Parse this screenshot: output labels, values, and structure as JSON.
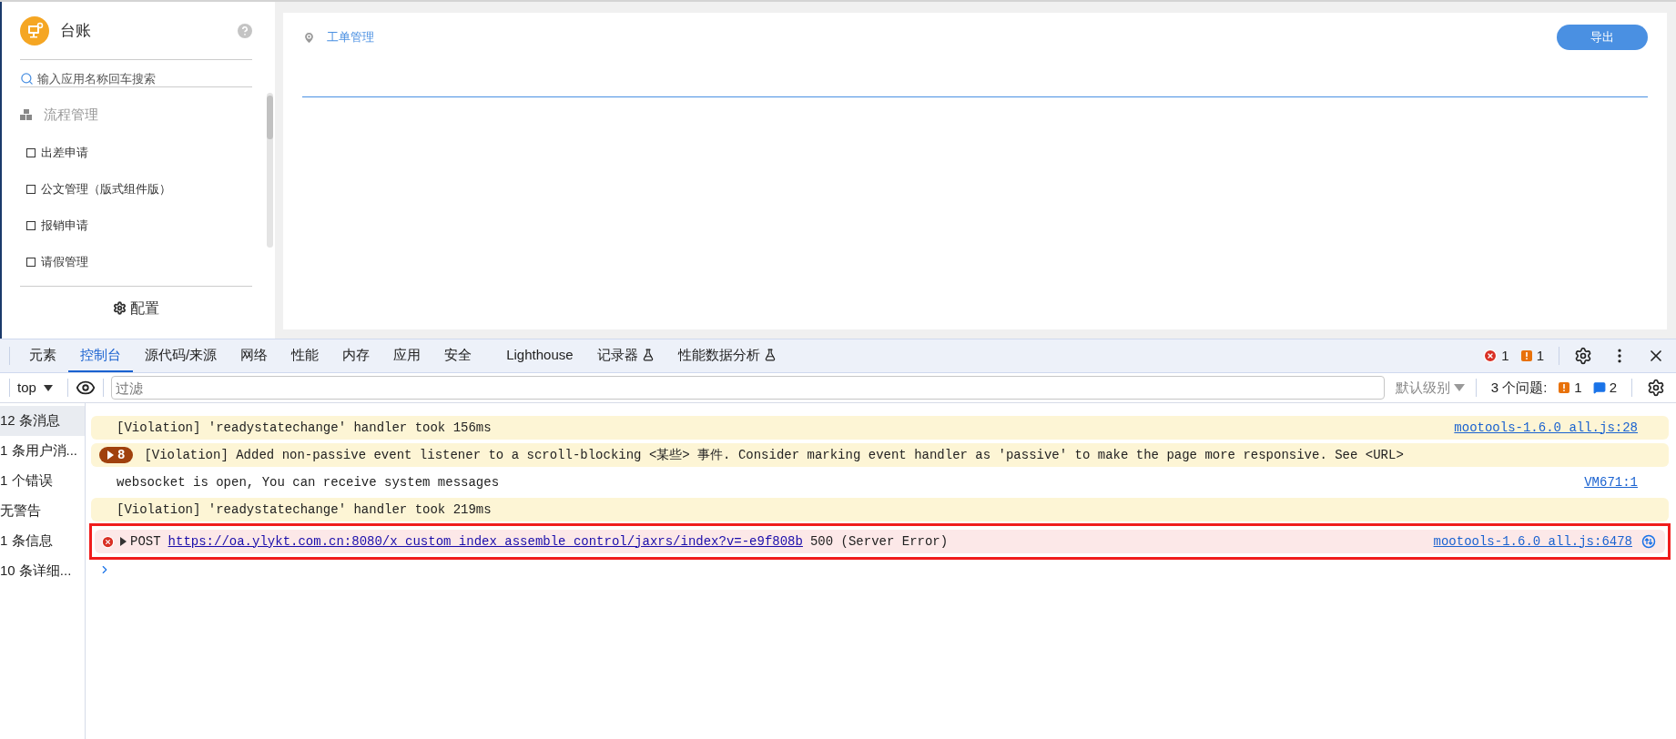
{
  "app": {
    "title": "台账",
    "search": {
      "placeholder": "输入应用名称回车搜索"
    },
    "group": "流程管理",
    "items": [
      {
        "label": "出差申请",
        "checked": false
      },
      {
        "label": "公文管理（版式组件版）",
        "checked": false
      },
      {
        "label": "报销申请",
        "checked": false
      },
      {
        "label": "请假管理",
        "checked": false
      }
    ],
    "config": "配置"
  },
  "main": {
    "breadcrumb": "工单管理",
    "export_button": "导出"
  },
  "devtools": {
    "tabs": [
      {
        "label": "元素",
        "selected": false,
        "experimental": false
      },
      {
        "label": "控制台",
        "selected": true,
        "experimental": false
      },
      {
        "label": "源代码/来源",
        "selected": false,
        "experimental": false
      },
      {
        "label": "网络",
        "selected": false,
        "experimental": false
      },
      {
        "label": "性能",
        "selected": false,
        "experimental": false
      },
      {
        "label": "内存",
        "selected": false,
        "experimental": false
      },
      {
        "label": "应用",
        "selected": false,
        "experimental": false
      },
      {
        "label": "安全",
        "selected": false,
        "experimental": false
      },
      {
        "label": "Lighthouse",
        "selected": false,
        "experimental": false
      },
      {
        "label": "记录器",
        "selected": false,
        "experimental": true
      },
      {
        "label": "性能数据分析",
        "selected": false,
        "experimental": true
      }
    ],
    "error_count": "1",
    "warning_count": "1",
    "toolbar": {
      "context": "top",
      "filter": {
        "placeholder": "过滤"
      },
      "level": "默认级别",
      "issues_label": "3 个问题:",
      "issue_warnings": "1",
      "issue_infos": "2"
    },
    "sidebar": [
      {
        "label": "12 条消息",
        "selected": true
      },
      {
        "label": "1 条用户消...",
        "selected": false
      },
      {
        "label": "1 个错误",
        "selected": false
      },
      {
        "label": "无警告",
        "selected": false
      },
      {
        "label": "1 条信息",
        "selected": false
      },
      {
        "label": "10 条详细...",
        "selected": false
      }
    ],
    "messages": [
      {
        "kind": "violation",
        "text": "[Violation] 'readystatechange' handler took 156ms",
        "source": "mootools-1.6.0_all.js:28",
        "highlighted": false
      },
      {
        "kind": "violation",
        "count": "8",
        "text": "[Violation] Added non-passive event listener to a scroll-blocking <某些> 事件. Consider marking event handler as 'passive' to make the page more responsive. See <URL>",
        "highlighted": false
      },
      {
        "kind": "info",
        "text": "websocket is open, You can receive system messages",
        "source": "VM671:1",
        "highlighted": false
      },
      {
        "kind": "violation",
        "text": "[Violation] 'readystatechange' handler took 219ms",
        "highlighted": false
      },
      {
        "kind": "error",
        "method": "POST",
        "url": "https://oa.ylykt.com.cn:8080/x_custom_index_assemble_control/jaxrs/index?v=-e9f808b",
        "text": "500 (Server Error)",
        "source": "mootools-1.6.0_all.js:6478",
        "highlighted": true
      }
    ]
  }
}
